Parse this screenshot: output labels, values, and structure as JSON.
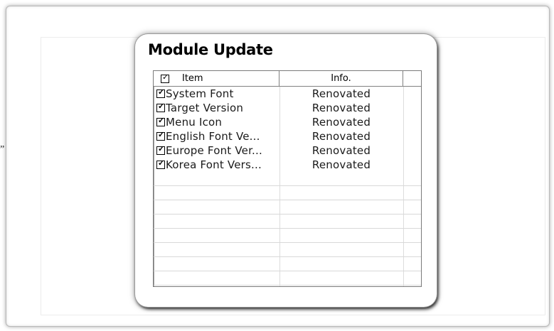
{
  "stray_text": "”",
  "dialog": {
    "title": "Module Update"
  },
  "list": {
    "header": {
      "checked": true,
      "item_label": "Item",
      "info_label": "Info."
    },
    "rows": [
      {
        "checked": true,
        "name": "System Font",
        "info": "Renovated"
      },
      {
        "checked": true,
        "name": "Target Version",
        "info": "Renovated"
      },
      {
        "checked": true,
        "name": "Menu Icon",
        "info": "Renovated"
      },
      {
        "checked": true,
        "name": "English Font Ve...",
        "info": "Renovated"
      },
      {
        "checked": true,
        "name": "Europe Font Ver...",
        "info": "Renovated"
      },
      {
        "checked": true,
        "name": "Korea Font Vers...",
        "info": "Renovated"
      }
    ]
  }
}
